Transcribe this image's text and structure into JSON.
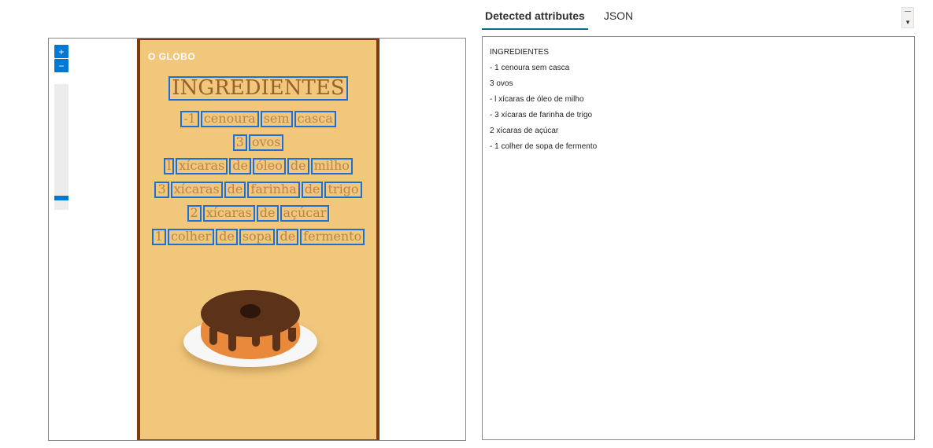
{
  "tabs": [
    {
      "label": "Detected attributes",
      "active": true
    },
    {
      "label": "JSON",
      "active": false
    }
  ],
  "image": {
    "brand": "O GLOBO",
    "ocr_title": [
      "INGREDIENTES"
    ],
    "ocr_lines": [
      [
        "-1",
        "cenoura",
        "sem",
        "casca"
      ],
      [
        "3",
        "ovos"
      ],
      [
        "l",
        "xícaras",
        "de",
        "óleo",
        "de",
        "milho"
      ],
      [
        "3",
        "xícaras",
        "de",
        "farinha",
        "de",
        "trigo"
      ],
      [
        "2",
        "xícaras",
        "de",
        "açúcar"
      ],
      [
        "1",
        "colher",
        "de",
        "sopa",
        "de",
        "fermento"
      ]
    ]
  },
  "results": [
    "INGREDIENTES",
    "- 1 cenoura sem casca",
    "3 ovos",
    "- l xícaras de óleo de milho",
    "- 3 xícaras de farinha de trigo",
    "2 xícaras de açúcar",
    "- 1 colher de sopa de fermento"
  ],
  "icons": {
    "zoom_in": "+",
    "zoom_out": "−",
    "scroll_down": "▾"
  },
  "colors": {
    "accent": "#0078d4",
    "tab_underline": "#0f6c8c",
    "bounding_box": "#1a6fd8",
    "poster_background": "#f1c77c",
    "poster_border": "#7b3a10"
  }
}
